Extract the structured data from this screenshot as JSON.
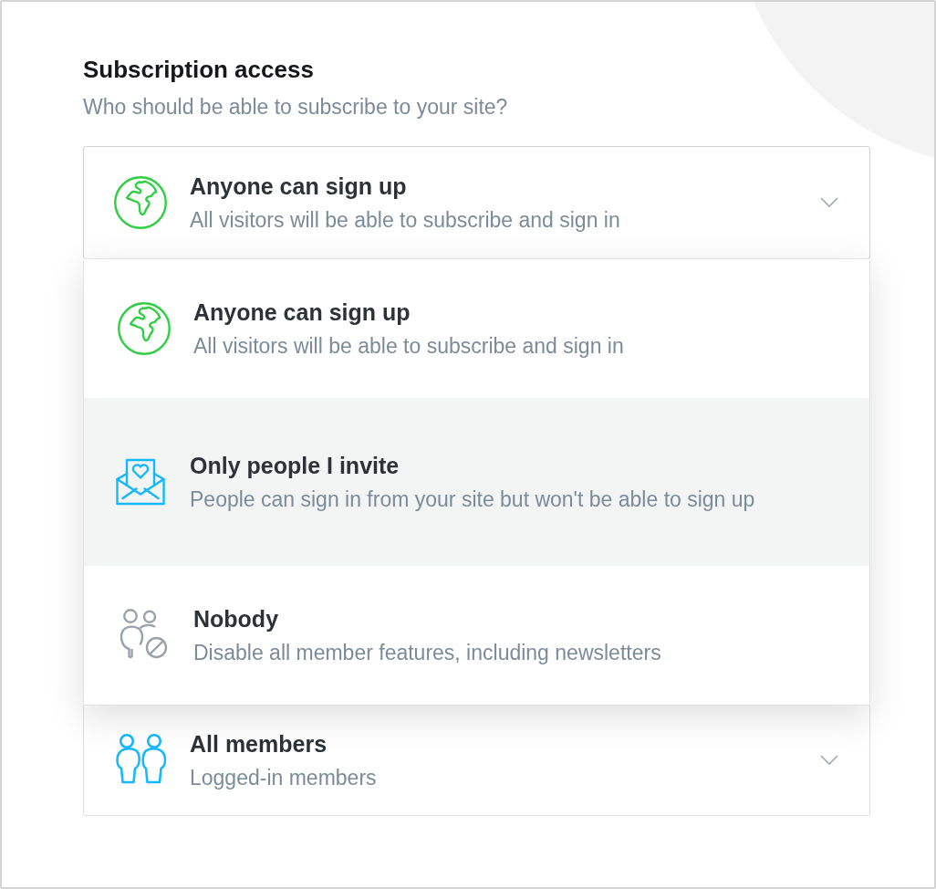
{
  "section": {
    "title": "Subscription access",
    "subtitle": "Who should be able to subscribe to your site?"
  },
  "access_select": {
    "kind": "anyone",
    "title": "Anyone can sign up",
    "description": "All visitors will be able to subscribe and sign in",
    "expanded": true
  },
  "access_options": [
    {
      "kind": "anyone",
      "title": "Anyone can sign up",
      "description": "All visitors will be able to subscribe and sign in",
      "highlighted": false
    },
    {
      "kind": "invite",
      "title": "Only people I invite",
      "description": "People can sign in from your site but won't be able to sign up",
      "highlighted": true
    },
    {
      "kind": "nobody",
      "title": "Nobody",
      "description": "Disable all member features, including newsletters",
      "highlighted": false
    }
  ],
  "members_select": {
    "kind": "members",
    "title": "All members",
    "description": "Logged-in members"
  }
}
